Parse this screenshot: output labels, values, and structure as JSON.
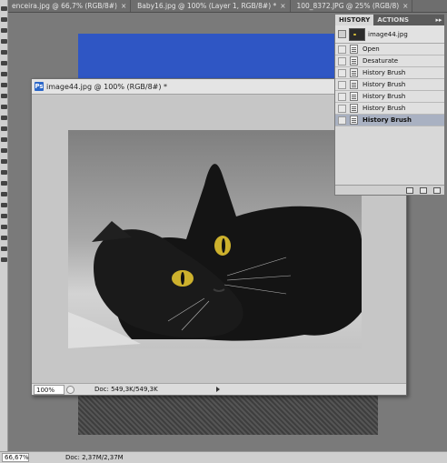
{
  "doc_tabs": [
    {
      "label": "enceira.jpg @ 66,7% (RGB/8#)",
      "close": "×"
    },
    {
      "label": "Baby16.jpg @ 100% (Layer 1, RGB/8#) *",
      "close": "×"
    },
    {
      "label": "100_8372.JPG @ 25% (RGB/8)",
      "close": "×"
    }
  ],
  "doc_window": {
    "icon_text": "Ps",
    "title": "image44.jpg @ 100% (RGB/8#) *",
    "zoom_value": "100%",
    "doc_size": "Doc: 549,3K/549,3K"
  },
  "history_panel": {
    "tabs": [
      "HISTORY",
      "ACTIONS"
    ],
    "menu_glyph": "▸▸",
    "snapshot_name": "image44.jpg",
    "states": [
      {
        "label": "Open",
        "selected": false
      },
      {
        "label": "Desaturate",
        "selected": false
      },
      {
        "label": "History Brush",
        "selected": false
      },
      {
        "label": "History Brush",
        "selected": false
      },
      {
        "label": "History Brush",
        "selected": false
      },
      {
        "label": "History Brush",
        "selected": false
      },
      {
        "label": "History Brush",
        "selected": true
      }
    ]
  },
  "app_status": {
    "zoom_value": "66,67%",
    "doc_size": "Doc: 2,37M/2,37M"
  },
  "colors": {
    "selected_row": "#a9b1c2",
    "accent_blue": "#2f56c4",
    "cat_eye": "#d9c13a"
  }
}
